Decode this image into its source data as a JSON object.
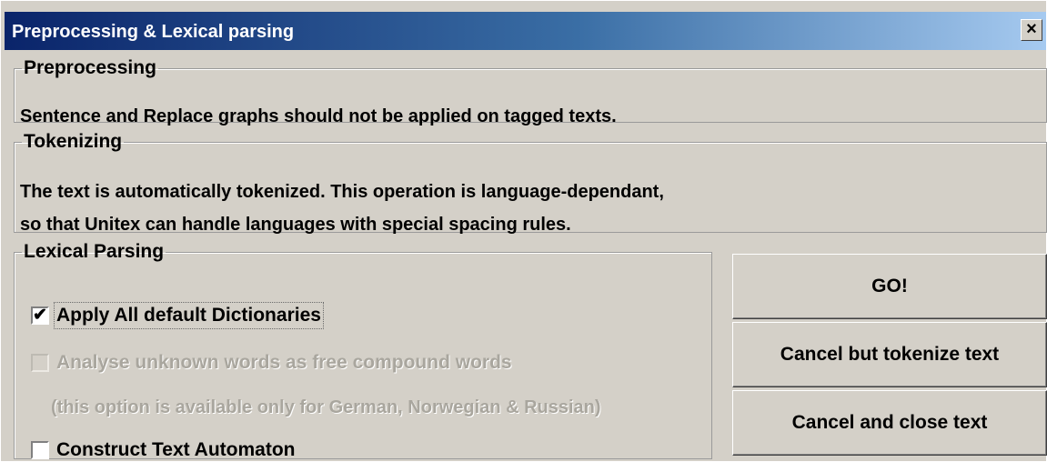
{
  "window": {
    "title": "Preprocessing & Lexical parsing",
    "close_glyph": "×"
  },
  "preprocessing": {
    "legend": "Preprocessing",
    "text": "Sentence and Replace graphs should not be applied on tagged texts."
  },
  "tokenizing": {
    "legend": "Tokenizing",
    "line1": "The text is automatically tokenized. This operation is language-dependant,",
    "line2": "so that Unitex can handle languages with special spacing rules."
  },
  "lexical": {
    "legend": "Lexical Parsing",
    "apply_dicts": {
      "label": "Apply All default Dictionaries",
      "checked": true,
      "enabled": true
    },
    "analyse_unknown": {
      "label": "Analyse unknown words as free compound words",
      "checked": false,
      "enabled": false
    },
    "note": "(this option is available only for German, Norwegian & Russian)",
    "construct_automaton": {
      "label": "Construct Text Automaton",
      "checked": false,
      "enabled": true
    },
    "check_glyph": "✔"
  },
  "buttons": {
    "go": "GO!",
    "cancel_tokenize": "Cancel but tokenize text",
    "cancel_close": "Cancel and close text"
  }
}
